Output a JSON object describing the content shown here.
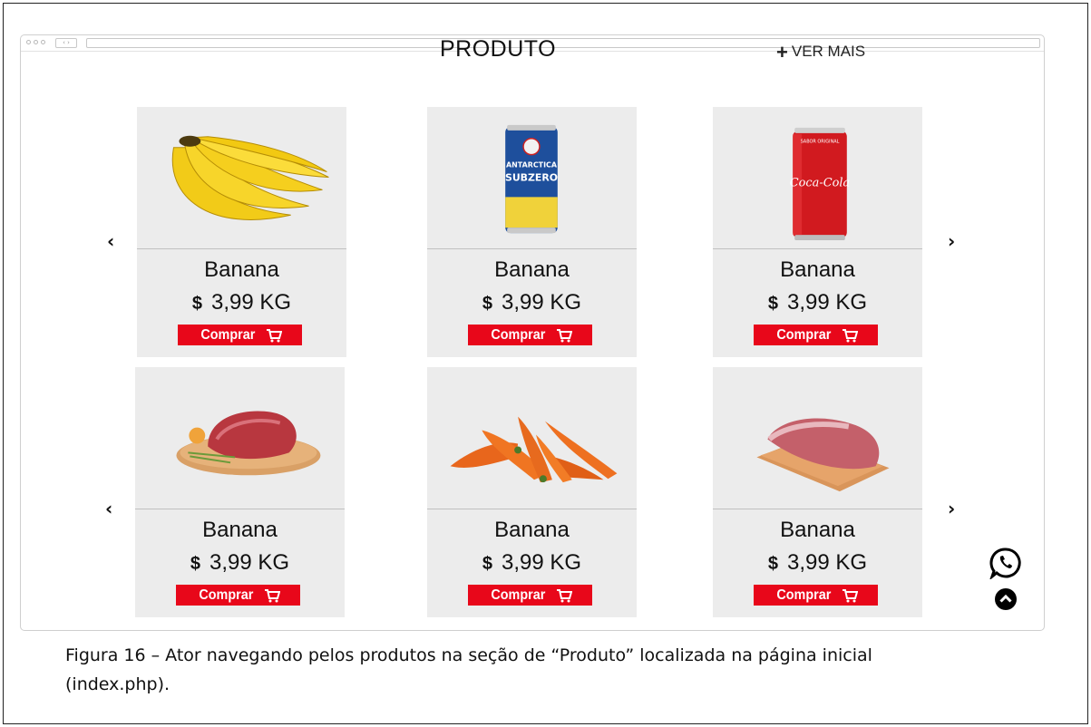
{
  "section": {
    "title": "PRODUTO",
    "ver_mais": "VER MAIS"
  },
  "nav": {
    "prev": "‹",
    "next": "›"
  },
  "products": [
    {
      "name": "Banana",
      "currency": "$",
      "price": "3,99 KG",
      "buy_label": "Comprar",
      "image": "bananas"
    },
    {
      "name": "Banana",
      "currency": "$",
      "price": "3,99 KG",
      "buy_label": "Comprar",
      "image": "beer-can-antarctica-subzero"
    },
    {
      "name": "Banana",
      "currency": "$",
      "price": "3,99 KG",
      "buy_label": "Comprar",
      "image": "coca-cola-can"
    },
    {
      "name": "Banana",
      "currency": "$",
      "price": "3,99 KG",
      "buy_label": "Comprar",
      "image": "beef-cut-on-board"
    },
    {
      "name": "Banana",
      "currency": "$",
      "price": "3,99 KG",
      "buy_label": "Comprar",
      "image": "carrots"
    },
    {
      "name": "Banana",
      "currency": "$",
      "price": "3,99 KG",
      "buy_label": "Comprar",
      "image": "pork-cut-on-board"
    }
  ],
  "can_labels": {
    "beer_line1": "ANTARCTICA",
    "beer_line2": "SUBZERO",
    "coke_top": "SABOR ORIGINAL",
    "coke_logo": "Coca-Cola"
  },
  "floating": {
    "whatsapp_icon": "whatsapp-icon",
    "back_to_top_icon": "chevron-up-circle-icon"
  },
  "caption": {
    "line1": "Figura 16 – Ator navegando pelos produtos na seção de “Produto” localizada na página inicial",
    "line2": "(index.php)."
  },
  "colors": {
    "buy_button": "#e8071a",
    "card_bg": "#ececec"
  }
}
